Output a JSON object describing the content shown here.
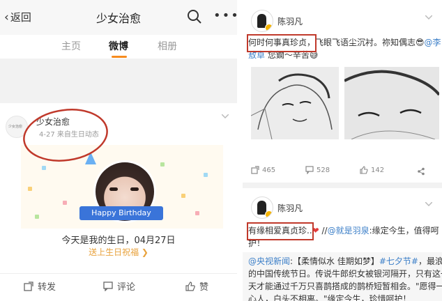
{
  "left": {
    "header": {
      "back_label": "返回",
      "title": "少女治愈"
    },
    "tabs": [
      {
        "label": "主页"
      },
      {
        "label": "微博"
      },
      {
        "label": "相册"
      }
    ],
    "post": {
      "username": "少女治愈",
      "meta": "4-27  来自生日动态",
      "avatar_text": "少女治愈",
      "banner_ribbon": "Happy Birthday",
      "message": "今天是我的生日，04月27日",
      "link": "送上生日祝福 ❯"
    },
    "actions": [
      {
        "label": "转发"
      },
      {
        "label": "评论"
      },
      {
        "label": "赞"
      }
    ],
    "colors": {
      "accent": "#f78c1f",
      "annotation": "#c0392b",
      "link": "#e8a23c"
    }
  },
  "right": {
    "post1": {
      "username": "陈羽凡",
      "highlight": "何时何事真珍贞，",
      "text_rest": "飞眼飞语尘沉衬。祢知偶志😎",
      "mention": "@李",
      "line2_mention": "敖卓",
      "line2_rest": " 您鐗～辛苦😅",
      "counts": {
        "repost": "465",
        "comment": "528",
        "like": "142"
      }
    },
    "post2": {
      "username": "陈羽凡",
      "highlight": "有缘相爱真贞珍..",
      "heart": "❤",
      "line1_rest": " //",
      "mention": "@就是羽泉",
      "line1_tail": ":缘定今生，值得呵",
      "line2": "护！",
      "quote_mention": "@央视新闻",
      "quote_text": ":【柔情似水 佳期如梦】",
      "hashtag": "#七夕节#",
      "quote_tail": "，最浪漫",
      "line4": "的中国传统节日。传说牛郎织女被银河隔开，只有这一",
      "line5": "天才能通过千万只喜鹊搭成的鹊桥短暂相会。\"愿得一",
      "line6": "心人，白头不相离。\"缘定今生，珍惜呵护！"
    }
  }
}
